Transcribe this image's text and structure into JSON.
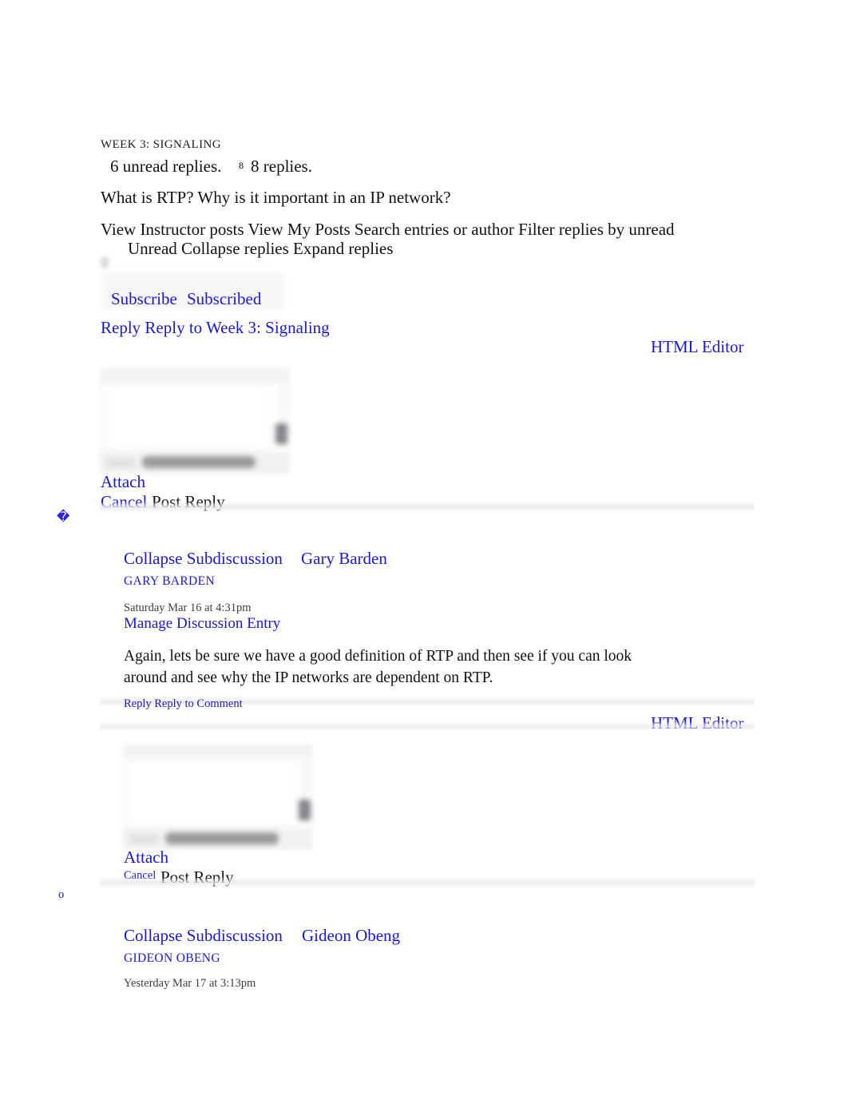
{
  "discussion": {
    "section_label": "WEEK 3: SIGNALING",
    "unread_replies": "6 unread replies.",
    "reply_count_badge": "8",
    "replies_total": "8 replies.",
    "prompt": "What is RTP? Why is it important in an IP network?",
    "toolbar_line_1": "View Instructor posts View My Posts Search entries or author Filter replies by unread",
    "toolbar_line_2": "Unread Collapse replies Expand replies",
    "subscribe_label": "Subscribe",
    "subscribed_label": "Subscribed",
    "reply_top": "Reply Reply to Week 3: Signaling",
    "bullet_glyph_1": "�",
    "bullet_glyph_2": "o"
  },
  "composer_top": {
    "html_editor_link": "HTML Editor",
    "attach_label": "Attach",
    "cancel_label": "Cancel",
    "post_reply_label": "Post Reply"
  },
  "composer_reply": {
    "html_editor_link": "HTML Editor",
    "attach_label": "Attach",
    "cancel_label": "Cancel",
    "post_reply_label": "Post Reply"
  },
  "posts": [
    {
      "collapse_label": "Collapse Subdiscussion",
      "author_link": "Gary Barden",
      "author_name": "GARY BARDEN",
      "timestamp": "Saturday Mar 16 at 4:31pm",
      "manage_label": "Manage Discussion Entry",
      "body": "Again, lets be sure we have a good definition of RTP and then see if you can look around and see why the IP networks are dependent on RTP.",
      "reply_label": "Reply Reply to Comment"
    },
    {
      "collapse_label": "Collapse Subdiscussion",
      "author_link": "Gideon Obeng",
      "author_name": "GIDEON OBENG",
      "timestamp": "Yesterday Mar 17 at 3:13pm"
    }
  ],
  "colors": {
    "link": "#1a18d8",
    "text": "#111111",
    "meta": "#3a3f45"
  }
}
